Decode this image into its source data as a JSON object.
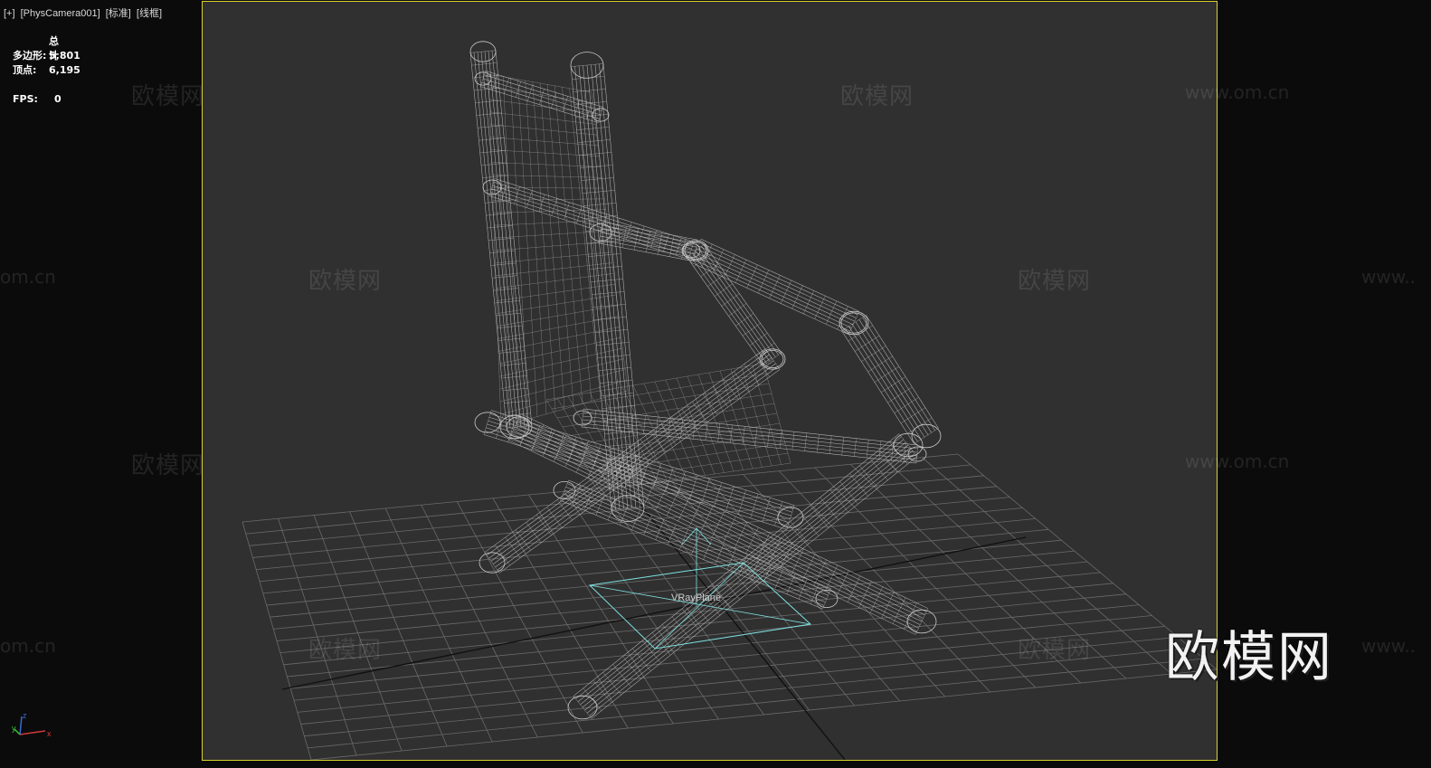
{
  "viewport": {
    "menu_label": "[+]",
    "camera_label": "[PhysCamera001]",
    "shading_std_label": "[标准]",
    "shading_wire_label": "[线框]"
  },
  "stats": {
    "header": "总计",
    "polygons_label": "多边形:",
    "polygons_value": "5,801",
    "vertices_label": "顶点:",
    "vertices_value": "6,195",
    "fps_label": "FPS:",
    "fps_value": "0"
  },
  "scene": {
    "light_label": "VRayPlane",
    "wire_color": "#c8c8c8",
    "grid_color": "#6a6a6a",
    "light_color": "#7fe0e0",
    "frame_color": "#d8cf30"
  },
  "watermarks": {
    "brand": "欧模网",
    "url": "www.om.cn",
    "url_partial": "om.cn",
    "url_prefix": "www.."
  },
  "gizmo": {
    "x_label": "x",
    "y_label": "y",
    "z_label": "z"
  }
}
